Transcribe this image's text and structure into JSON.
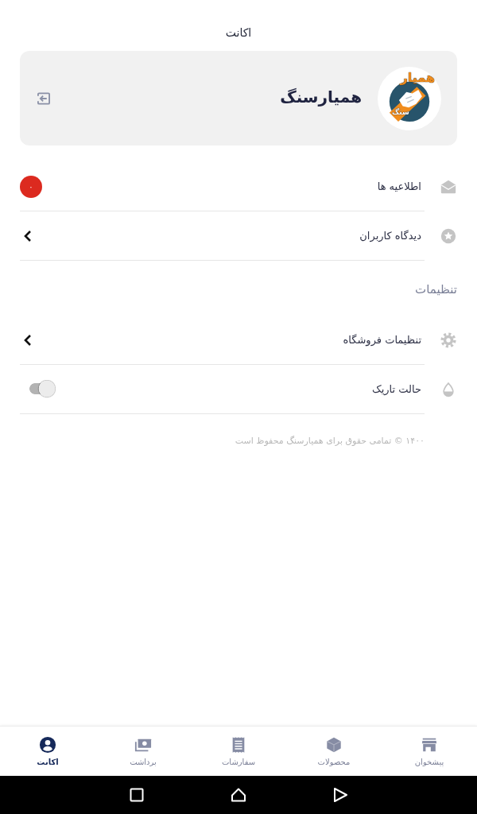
{
  "header": {
    "title": "اکانت"
  },
  "profile": {
    "name": "همیارسنگ",
    "logo": {
      "top_text": "همیار",
      "bottom_text": "سنگ"
    }
  },
  "menu": [
    {
      "kind": "badge",
      "label": "اطلاعیه ها",
      "badge": "۰"
    },
    {
      "kind": "link",
      "label": "دیدگاه کاربران"
    }
  ],
  "settings": {
    "title": "تنظیمات",
    "items": [
      {
        "kind": "link",
        "label": "تنظیمات فروشگاه"
      },
      {
        "kind": "toggle",
        "label": "حالت تاریک",
        "on": false
      }
    ]
  },
  "footer": "۱۴۰۰ © تمامی حقوق برای همیارسنگ محفوظ است",
  "bottom_nav": [
    {
      "label": "پیشخوان",
      "selected": false
    },
    {
      "label": "محصولات",
      "selected": false
    },
    {
      "label": "سفارشات",
      "selected": false
    },
    {
      "label": "برداشت",
      "selected": false
    },
    {
      "label": "اکانت",
      "selected": true
    }
  ]
}
